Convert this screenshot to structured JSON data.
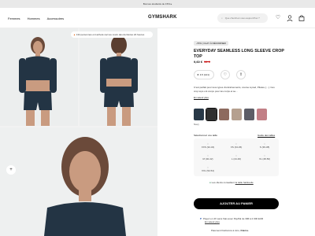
{
  "promo": "Bonnes étudiants de 15% ▸",
  "header": {
    "nav": [
      "Femmes",
      "Hommes",
      "Accessoires"
    ],
    "logo": "GYMSHARK",
    "search_placeholder": "Que cherchez-vous aujourd'hui ?",
    "icons": [
      "heart-icon",
      "user-icon",
      "bag-icon"
    ]
  },
  "gallery": {
    "notice": "134 personnes ont acheté ceci au cours des dernières 24 heures",
    "expand_icon": "+"
  },
  "product": {
    "badge": "-70% | CLAY À DÉCORNER",
    "title": "EVERYDAY SEAMLESS LONG SLEEVE CROP TOP",
    "price": "9,60 €",
    "old_price": "32 €",
    "rating": "4.5",
    "reviews": "(121)",
    "description": "C'est parfait pour tous types d'entraînements, course à pied, Pilates, [...]. Ces crop tops ont conçu pour les corps et se...",
    "read_more": "En savoir plus",
    "color_label": "Navy",
    "size_header": "Sélectionnez une taille",
    "size_guide": "Guide des tailles",
    "sizes": [
      "XXS (32-34)",
      "XS (34-36)",
      "S (36-38)",
      "M (40-42)",
      "L (44-46)",
      "XL (48-50)",
      "XXL (52-54)"
    ],
    "fit_note": "Les clients conseillent",
    "fit_link": "la taille habituelle",
    "cart_button": "AJOUTER AU PANIER",
    "paypal": "Payez en 4X sans frais avec PayPal de 30€ à 2 000 EUR",
    "paypal_link": "En savoir plus",
    "klarna": "Paiement fractionné à zéro, ",
    "klarna_brand": "Klarna."
  }
}
